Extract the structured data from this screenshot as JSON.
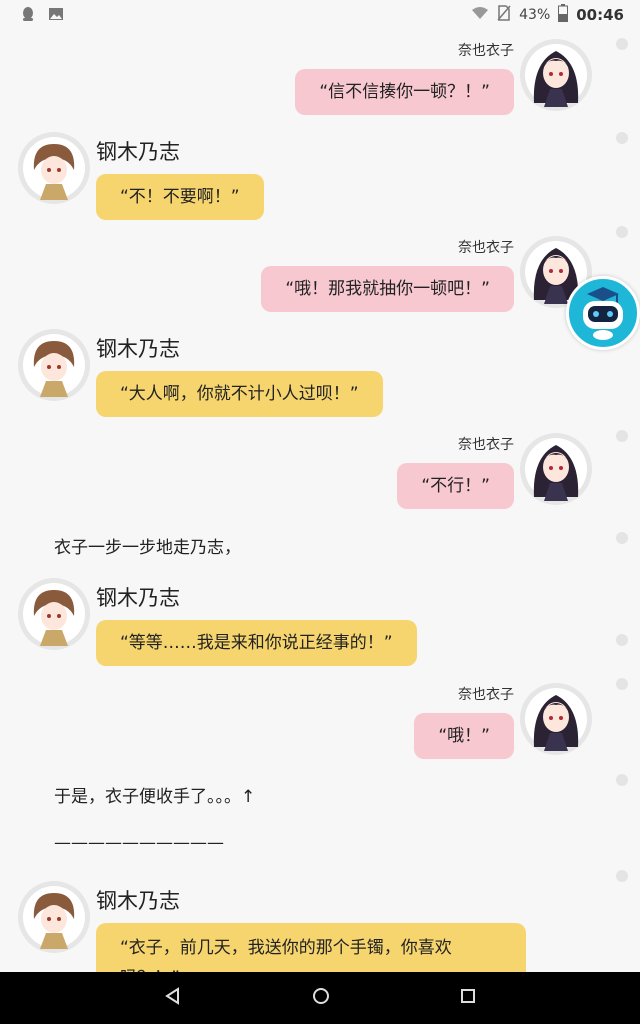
{
  "status_bar": {
    "battery": "43%",
    "time": "00:46"
  },
  "messages": [
    {
      "side": "right",
      "sender": "奈也衣子",
      "text": "“信不信揍你一顿？！”"
    },
    {
      "side": "left",
      "sender": "钢木乃志",
      "text": "“不！不要啊！”"
    },
    {
      "side": "right",
      "sender": "奈也衣子",
      "text": "“哦！那我就抽你一顿吧！”"
    },
    {
      "side": "left",
      "sender": "钢木乃志",
      "text": "“大人啊，你就不计小人过呗！”"
    },
    {
      "side": "right",
      "sender": "奈也衣子",
      "text": "“不行！”"
    },
    {
      "side": "narration",
      "text": "衣子一步一步地走乃志，"
    },
    {
      "side": "left",
      "sender": "钢木乃志",
      "text": "“等等……我是来和你说正经事的！”"
    },
    {
      "side": "right",
      "sender": "奈也衣子",
      "text": "“哦！”"
    },
    {
      "side": "narration",
      "text": "于是，衣子便收手了。。。↑"
    },
    {
      "side": "narration",
      "text": "——————————"
    },
    {
      "side": "left",
      "sender": "钢木乃志",
      "text": "“衣子，前几天，我送你的那个手镯，你喜欢吗？！”"
    }
  ],
  "icons": [
    "qq-icon",
    "gallery-icon",
    "wifi-icon",
    "no-sim-icon",
    "battery-icon",
    "robot-assistant-icon",
    "back-icon",
    "home-icon",
    "recents-icon"
  ],
  "colors": {
    "right_bubble": "#f7c8d0",
    "left_bubble": "#f6d56e",
    "background": "#f7f7f7"
  }
}
